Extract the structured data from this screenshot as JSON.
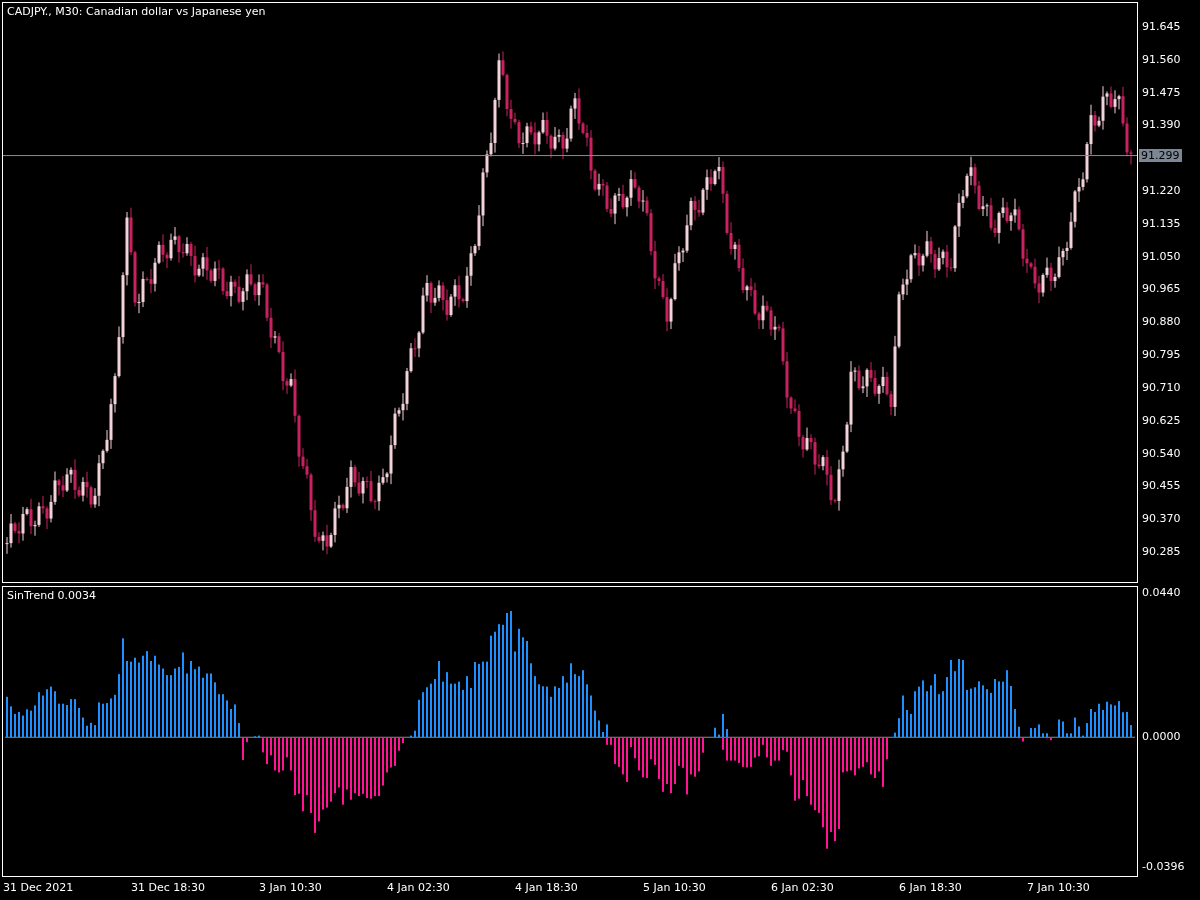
{
  "chart": {
    "title": "CADJPY., M30:  Canadian dollar vs Japanese yen",
    "price_ticks": [
      "91.645",
      "91.560",
      "91.475",
      "91.390",
      "91.220",
      "91.135",
      "91.050",
      "90.965",
      "90.880",
      "90.795",
      "90.710",
      "90.625",
      "90.540",
      "90.455",
      "90.370",
      "90.285"
    ],
    "current_price": "91.299"
  },
  "indicator": {
    "label": "SinTrend 0.0034",
    "chart_data": {
      "type": "bar",
      "ylim": [
        -0.0422,
        0.0457
      ],
      "yticks": [
        {
          "value": 0.044,
          "label": "0.0440"
        },
        {
          "value": 0,
          "label": "0.0000"
        },
        {
          "value": -0.0396,
          "label": "-0.0396"
        }
      ],
      "series": [
        {
          "color": "#1e90ff",
          "values": [
            0.0123,
            0.0094,
            0.0071,
            0.0077,
            0.0066,
            0.0085,
            0.0081,
            0.0097,
            0.0137,
            0.0127,
            0.0146,
            0.0154,
            0.014,
            0.0102,
            0.0102,
            0.0098,
            0.0116,
            0.0116,
            0.0089,
            0.006,
            0.0035,
            0.0044,
            0.0037,
            0.0106,
            0.0102,
            0.0104,
            0.0118,
            0.0129,
            0.0192,
            0.0301,
            0.0232,
            0.023,
            0.0242,
            0.0227,
            0.0248,
            0.0262,
            0.0232,
            0.0248,
            0.0221,
            0.0209,
            0.0189,
            0.0189,
            0.0209,
            0.0214,
            0.0258,
            0.0194,
            0.0232,
            0.0207,
            0.0215,
            0.0181,
            0.0194,
            0.0194,
            0.0167,
            0.0131,
            0.0131,
            0.0112,
            0.0086,
            0.01,
            0.0043,
            null,
            null,
            null,
            0.0003,
            0.0005,
            null,
            null,
            null,
            null,
            null,
            null,
            null,
            null,
            null,
            null,
            null,
            null,
            null,
            null,
            null,
            null,
            null,
            null,
            null,
            null,
            null,
            null,
            null,
            null,
            null,
            null,
            null,
            null,
            null,
            null,
            null,
            null,
            null,
            null,
            null,
            null,
            null,
            0.0005,
            0.002,
            0.0114,
            0.0137,
            0.0152,
            0.0163,
            0.0177,
            0.0232,
            0.0169,
            0.0198,
            0.0163,
            0.0163,
            0.0169,
            0.0144,
            0.0186,
            0.015,
            0.0229,
            0.0223,
            0.023,
            0.023,
            0.0309,
            0.0321,
            0.0344,
            0.0342,
            0.0378,
            0.0384,
            0.0261,
            0.033,
            0.0304,
            0.0293,
            0.0225,
            0.0186,
            0.0161,
            0.0155,
            0.0154,
            0.0123,
            0.0155,
            0.015,
            0.0186,
            0.0166,
            0.0225,
            0.0192,
            0.0186,
            0.0204,
            0.0161,
            0.0127,
            0.0081,
            0.0051,
            0.0016,
            0.0039,
            null,
            null,
            null,
            null,
            null,
            null,
            null,
            null,
            null,
            null,
            null,
            null,
            null,
            null,
            null,
            null,
            null,
            null,
            null,
            null,
            null,
            null,
            null,
            null,
            null,
            null,
            0.0029,
            0.0008,
            0.0071,
            0.0025,
            null,
            null,
            null,
            null,
            null,
            null,
            null,
            null,
            null,
            null,
            null,
            null,
            null,
            null,
            null,
            null,
            null,
            null,
            null,
            null,
            null,
            null,
            null,
            null,
            null,
            null,
            null,
            null,
            null,
            null,
            null,
            null,
            null,
            null,
            null,
            null,
            null,
            null,
            null,
            null,
            null,
            0.0014,
            0.0058,
            0.0127,
            0.0083,
            0.0071,
            0.014,
            0.0154,
            0.0173,
            0.014,
            0.0158,
            0.0192,
            0.0131,
            0.014,
            0.0183,
            0.0235,
            0.0201,
            0.0238,
            0.0235,
            0.0144,
            0.0148,
            0.0152,
            0.017,
            0.0158,
            0.0146,
            0.0135,
            0.0177,
            0.017,
            0.0169,
            0.0204,
            0.0156,
            0.0086,
            0.0032,
            null,
            null,
            0.0028,
            0.0028,
            0.0039,
            0.0012,
            0.0012,
            null,
            null,
            0.0054,
            0.0048,
            0.0012,
            0.0012,
            0.006,
            0.0033,
            0.0005,
            0.0043,
            0.0086,
            0.0077,
            0.0102,
            0.0083,
            0.0108,
            0.01,
            0.0097,
            0.011,
            0.0076,
            0.0077,
            0.0037
          ]
        },
        {
          "color": "#ff1493",
          "values": [
            null,
            null,
            null,
            null,
            null,
            null,
            null,
            null,
            null,
            null,
            null,
            null,
            null,
            null,
            null,
            null,
            null,
            null,
            null,
            null,
            null,
            null,
            null,
            null,
            null,
            null,
            null,
            null,
            null,
            null,
            null,
            null,
            null,
            null,
            null,
            null,
            null,
            null,
            null,
            null,
            null,
            null,
            null,
            null,
            null,
            null,
            null,
            null,
            null,
            null,
            null,
            null,
            null,
            null,
            null,
            null,
            null,
            null,
            null,
            -0.0069,
            -0.0015,
            null,
            null,
            null,
            -0.0046,
            -0.0082,
            -0.0055,
            -0.0101,
            -0.0107,
            -0.0101,
            -0.0061,
            -0.0101,
            -0.0176,
            -0.0172,
            -0.0225,
            -0.0176,
            -0.023,
            -0.0291,
            -0.0256,
            -0.022,
            -0.0214,
            -0.0196,
            -0.017,
            -0.0153,
            -0.0205,
            -0.0159,
            -0.019,
            -0.017,
            -0.0179,
            -0.0172,
            -0.0185,
            -0.0187,
            -0.0179,
            -0.0179,
            -0.0147,
            -0.0107,
            -0.0092,
            -0.0087,
            -0.0041,
            -0.0018,
            null,
            null,
            null,
            null,
            null,
            null,
            null,
            null,
            null,
            null,
            null,
            null,
            null,
            null,
            null,
            null,
            null,
            null,
            null,
            null,
            null,
            null,
            null,
            null,
            null,
            null,
            null,
            null,
            null,
            null,
            null,
            null,
            null,
            null,
            null,
            null,
            null,
            null,
            null,
            null,
            null,
            null,
            null,
            null,
            null,
            null,
            null,
            null,
            null,
            null,
            -0.0023,
            -0.0023,
            -0.0081,
            -0.009,
            -0.0113,
            -0.0136,
            -0.003,
            -0.0064,
            -0.0101,
            -0.0122,
            -0.0124,
            -0.0067,
            -0.0084,
            -0.0127,
            -0.0166,
            -0.0142,
            -0.017,
            -0.0142,
            -0.0087,
            -0.0093,
            -0.0174,
            -0.0113,
            -0.012,
            -0.0104,
            -0.0047,
            null,
            null,
            null,
            null,
            -0.0038,
            -0.0071,
            -0.0071,
            -0.0071,
            -0.0078,
            -0.009,
            -0.0092,
            -0.009,
            -0.0062,
            -0.0058,
            -0.0023,
            -0.0061,
            -0.0087,
            -0.0071,
            -0.0071,
            -0.0039,
            -0.0044,
            -0.0116,
            -0.0193,
            -0.0187,
            -0.013,
            -0.0179,
            -0.0205,
            -0.0222,
            -0.023,
            -0.0274,
            -0.0339,
            -0.0288,
            -0.0316,
            -0.0279,
            -0.0107,
            -0.0104,
            -0.0101,
            -0.0116,
            -0.0095,
            -0.009,
            -0.0076,
            -0.0113,
            -0.0124,
            -0.0104,
            -0.0151,
            -0.0067,
            null,
            null,
            null,
            null,
            null,
            null,
            null,
            null,
            null,
            null,
            null,
            null,
            null,
            null,
            null,
            null,
            null,
            null,
            null,
            null,
            null,
            null,
            null,
            null,
            null,
            null,
            null,
            null,
            null,
            null,
            null,
            null,
            -0.0003,
            -0.0013,
            null,
            null,
            null,
            null,
            null,
            -0.0003,
            -0.0009,
            null,
            null,
            null,
            null,
            null,
            null,
            null,
            null,
            null,
            null,
            null,
            null,
            null,
            null,
            null,
            null,
            null,
            null,
            null
          ]
        }
      ]
    }
  },
  "time_axis": [
    "31 Dec 2021",
    "31 Dec 18:30",
    "3 Jan 10:30",
    "4 Jan 02:30",
    "4 Jan 18:30",
    "5 Jan 10:30",
    "6 Jan 02:30",
    "6 Jan 18:30",
    "7 Jan 10:30"
  ]
}
